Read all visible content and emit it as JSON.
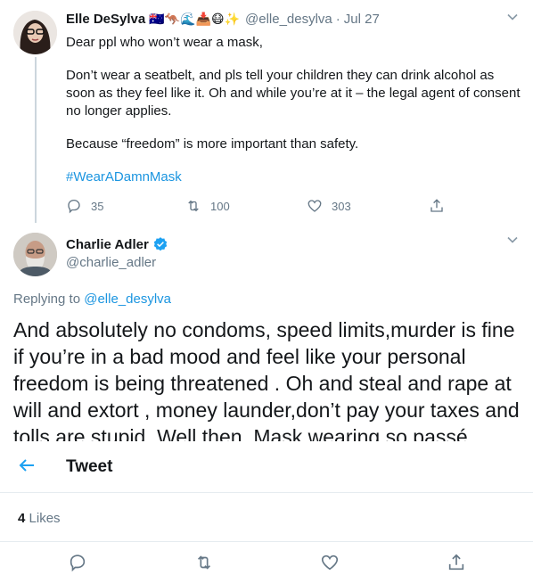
{
  "parent_tweet": {
    "author_name": "Elle DeSylva",
    "emoji_badges": "🇦🇺🦘🌊📥😷✨",
    "handle": "@elle_desylva",
    "separator": "·",
    "date": "Jul 27",
    "paragraphs": [
      "Dear ppl who won’t wear a mask,",
      "Don’t wear a seatbelt, and pls tell your children they can drink alcohol as soon as they feel like it. Oh and while you’re at it – the legal agent of consent no longer applies.",
      "Because “freedom” is more important than safety."
    ],
    "hashtag": "#WearADamnMask",
    "reply_count": "35",
    "retweet_count": "100",
    "like_count": "303"
  },
  "reply_tweet": {
    "author_name": "Charlie Adler",
    "verified": true,
    "handle": "@charlie_adler",
    "replying_prefix": "Replying to",
    "replying_to": "@elle_desylva",
    "text": "And absolutely no condoms, speed limits,murder is fine if you’re in a bad mood and feel like your personal freedom is being threatened . Oh and steal and rape at will and extort , money launder,don’t pay your taxes and tolls are stupid. Well then. Mask wearing so passé"
  },
  "topbar": {
    "title": "Tweet"
  },
  "likes": {
    "count": "4",
    "label": "Likes"
  },
  "colors": {
    "accent": "#1b95e0",
    "muted": "#657786",
    "text": "#14171a",
    "border": "#e6ecf0"
  },
  "icons": {
    "reply": "reply-icon",
    "retweet": "retweet-icon",
    "like": "heart-icon",
    "share": "share-icon",
    "back": "back-arrow-icon",
    "more": "chevron-down-icon",
    "verified": "verified-badge-icon"
  }
}
